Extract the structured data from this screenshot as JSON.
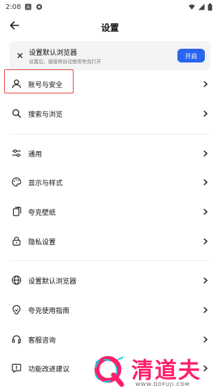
{
  "status_bar": {
    "time": "2:08"
  },
  "app_bar": {
    "title": "设置"
  },
  "default_card": {
    "title": "设置默认浏览器",
    "subtitle": "设置后，链接将自动使用夸克打开",
    "button": "开启"
  },
  "menu": [
    {
      "label": "账号与安全",
      "icon": "person-icon"
    },
    {
      "label": "搜索与浏览",
      "icon": "search-icon"
    },
    {
      "label": "通用",
      "icon": "sliders-icon"
    },
    {
      "label": "显示与样式",
      "icon": "palette-icon"
    },
    {
      "label": "夸克壁纸",
      "icon": "wallpaper-icon"
    },
    {
      "label": "隐私设置",
      "icon": "lock-icon"
    },
    {
      "label": "设置默认浏览器",
      "icon": "globe-icon"
    },
    {
      "label": "夸克使用指南",
      "icon": "guide-icon"
    },
    {
      "label": "客服咨询",
      "icon": "headset-icon"
    },
    {
      "label": "功能改进建议",
      "icon": "feedback-icon"
    }
  ],
  "watermark": {
    "text": "清道夫",
    "url": "WWW.QDFUJI.COM"
  },
  "colors": {
    "accent": "#2a65f0",
    "highlight": "#e53935",
    "watermark": "#ff1f6b"
  }
}
